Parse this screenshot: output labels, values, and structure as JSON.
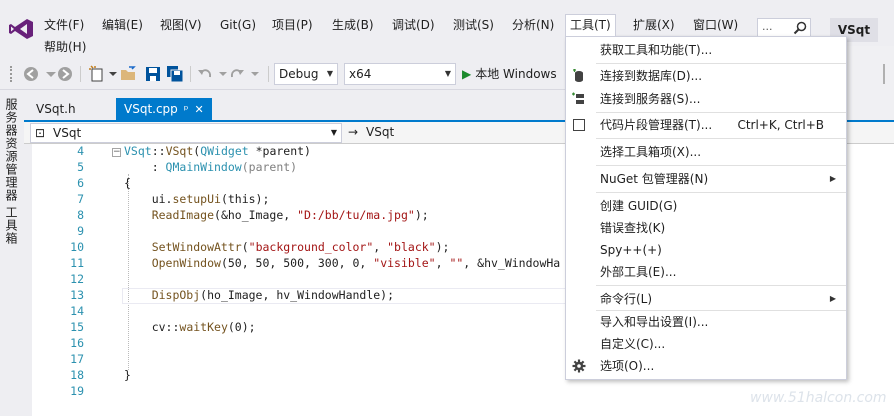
{
  "menubar": {
    "items": [
      "文件(F)",
      "编辑(E)",
      "视图(V)",
      "Git(G)",
      "项目(P)",
      "生成(B)",
      "调试(D)",
      "测试(S)",
      "分析(N)",
      "工具(T)",
      "扩展(X)",
      "窗口(W)"
    ],
    "help": "帮助(H)",
    "search_placeholder": "...",
    "project_name": "VSqt"
  },
  "toolbar": {
    "config": "Debug",
    "platform": "x64",
    "run_label": "本地 Windows"
  },
  "side_tabs": [
    "服务器资源管理器",
    "工具箱"
  ],
  "doc_tabs": {
    "inactive": "VSqt.h",
    "active": "VSqt.cpp",
    "pin": "ᵖ",
    "close": "✕"
  },
  "navbar": {
    "left": "VSqt",
    "right": "VSqt"
  },
  "editor": {
    "line_numbers": [
      "4",
      "5",
      "6",
      "7",
      "8",
      "9",
      "10",
      "11",
      "12",
      "13",
      "14",
      "15",
      "16",
      "17",
      "18",
      "19"
    ],
    "code": {
      "l4_a": "VSqt",
      "l4_b": "::",
      "l4_c": "VSqt",
      "l4_d": "(",
      "l4_e": "QWidget",
      "l4_f": " *parent)",
      "l5_a": "    : ",
      "l5_b": "QMainWindow",
      "l5_c": "(parent)",
      "l6": "{",
      "l7_a": "    ui.",
      "l7_b": "setupUi",
      "l7_c": "(this);",
      "l8_a": "    ReadImage",
      "l8_b": "(&ho_Image, ",
      "l8_c": "\"D:/bb/tu/ma.jpg\"",
      "l8_d": ");",
      "l10_a": "    SetWindowAttr",
      "l10_b": "(",
      "l10_c": "\"background_color\"",
      "l10_d": ", ",
      "l10_e": "\"black\"",
      "l10_f": ");",
      "l11_a": "    OpenWindow",
      "l11_b": "(50, 50, 500, 300, 0, ",
      "l11_c": "\"visible\"",
      "l11_d": ", ",
      "l11_e": "\"\"",
      "l11_f": ", &hv_WindowHa",
      "l13_a": "    DispObj",
      "l13_b": "(ho_Image, hv_WindowHandle);",
      "l15_a": "    cv",
      "l15_b": "::",
      "l15_c": "waitKey",
      "l15_d": "(0);",
      "l18": "}"
    }
  },
  "tools_menu": {
    "items": [
      {
        "label": "获取工具和功能(T)...",
        "icon": "none"
      },
      {
        "label": "连接到数据库(D)...",
        "icon": "database-icon"
      },
      {
        "label": "连接到服务器(S)...",
        "icon": "server-icon"
      },
      {
        "label": "代码片段管理器(T)...",
        "icon": "checkbox-icon",
        "shortcut": "Ctrl+K, Ctrl+B"
      },
      {
        "label": "选择工具箱项(X)...",
        "icon": "none"
      },
      {
        "label": "NuGet 包管理器(N)",
        "icon": "none",
        "submenu": true
      },
      {
        "label": "创建 GUID(G)",
        "icon": "none"
      },
      {
        "label": "错误查找(K)",
        "icon": "none"
      },
      {
        "label": "Spy++(+)",
        "icon": "none"
      },
      {
        "label": "外部工具(E)...",
        "icon": "none"
      },
      {
        "label": "命令行(L)",
        "icon": "none",
        "submenu": true
      },
      {
        "label": "导入和导出设置(I)...",
        "icon": "none"
      },
      {
        "label": "自定义(C)...",
        "icon": "none"
      },
      {
        "label": "选项(O)...",
        "icon": "gear-icon"
      }
    ],
    "submenu_arrow": "▶"
  },
  "colors": {
    "accent": "#007acc",
    "vs_purple": "#68217a"
  },
  "watermark": "www.51halcon.com"
}
